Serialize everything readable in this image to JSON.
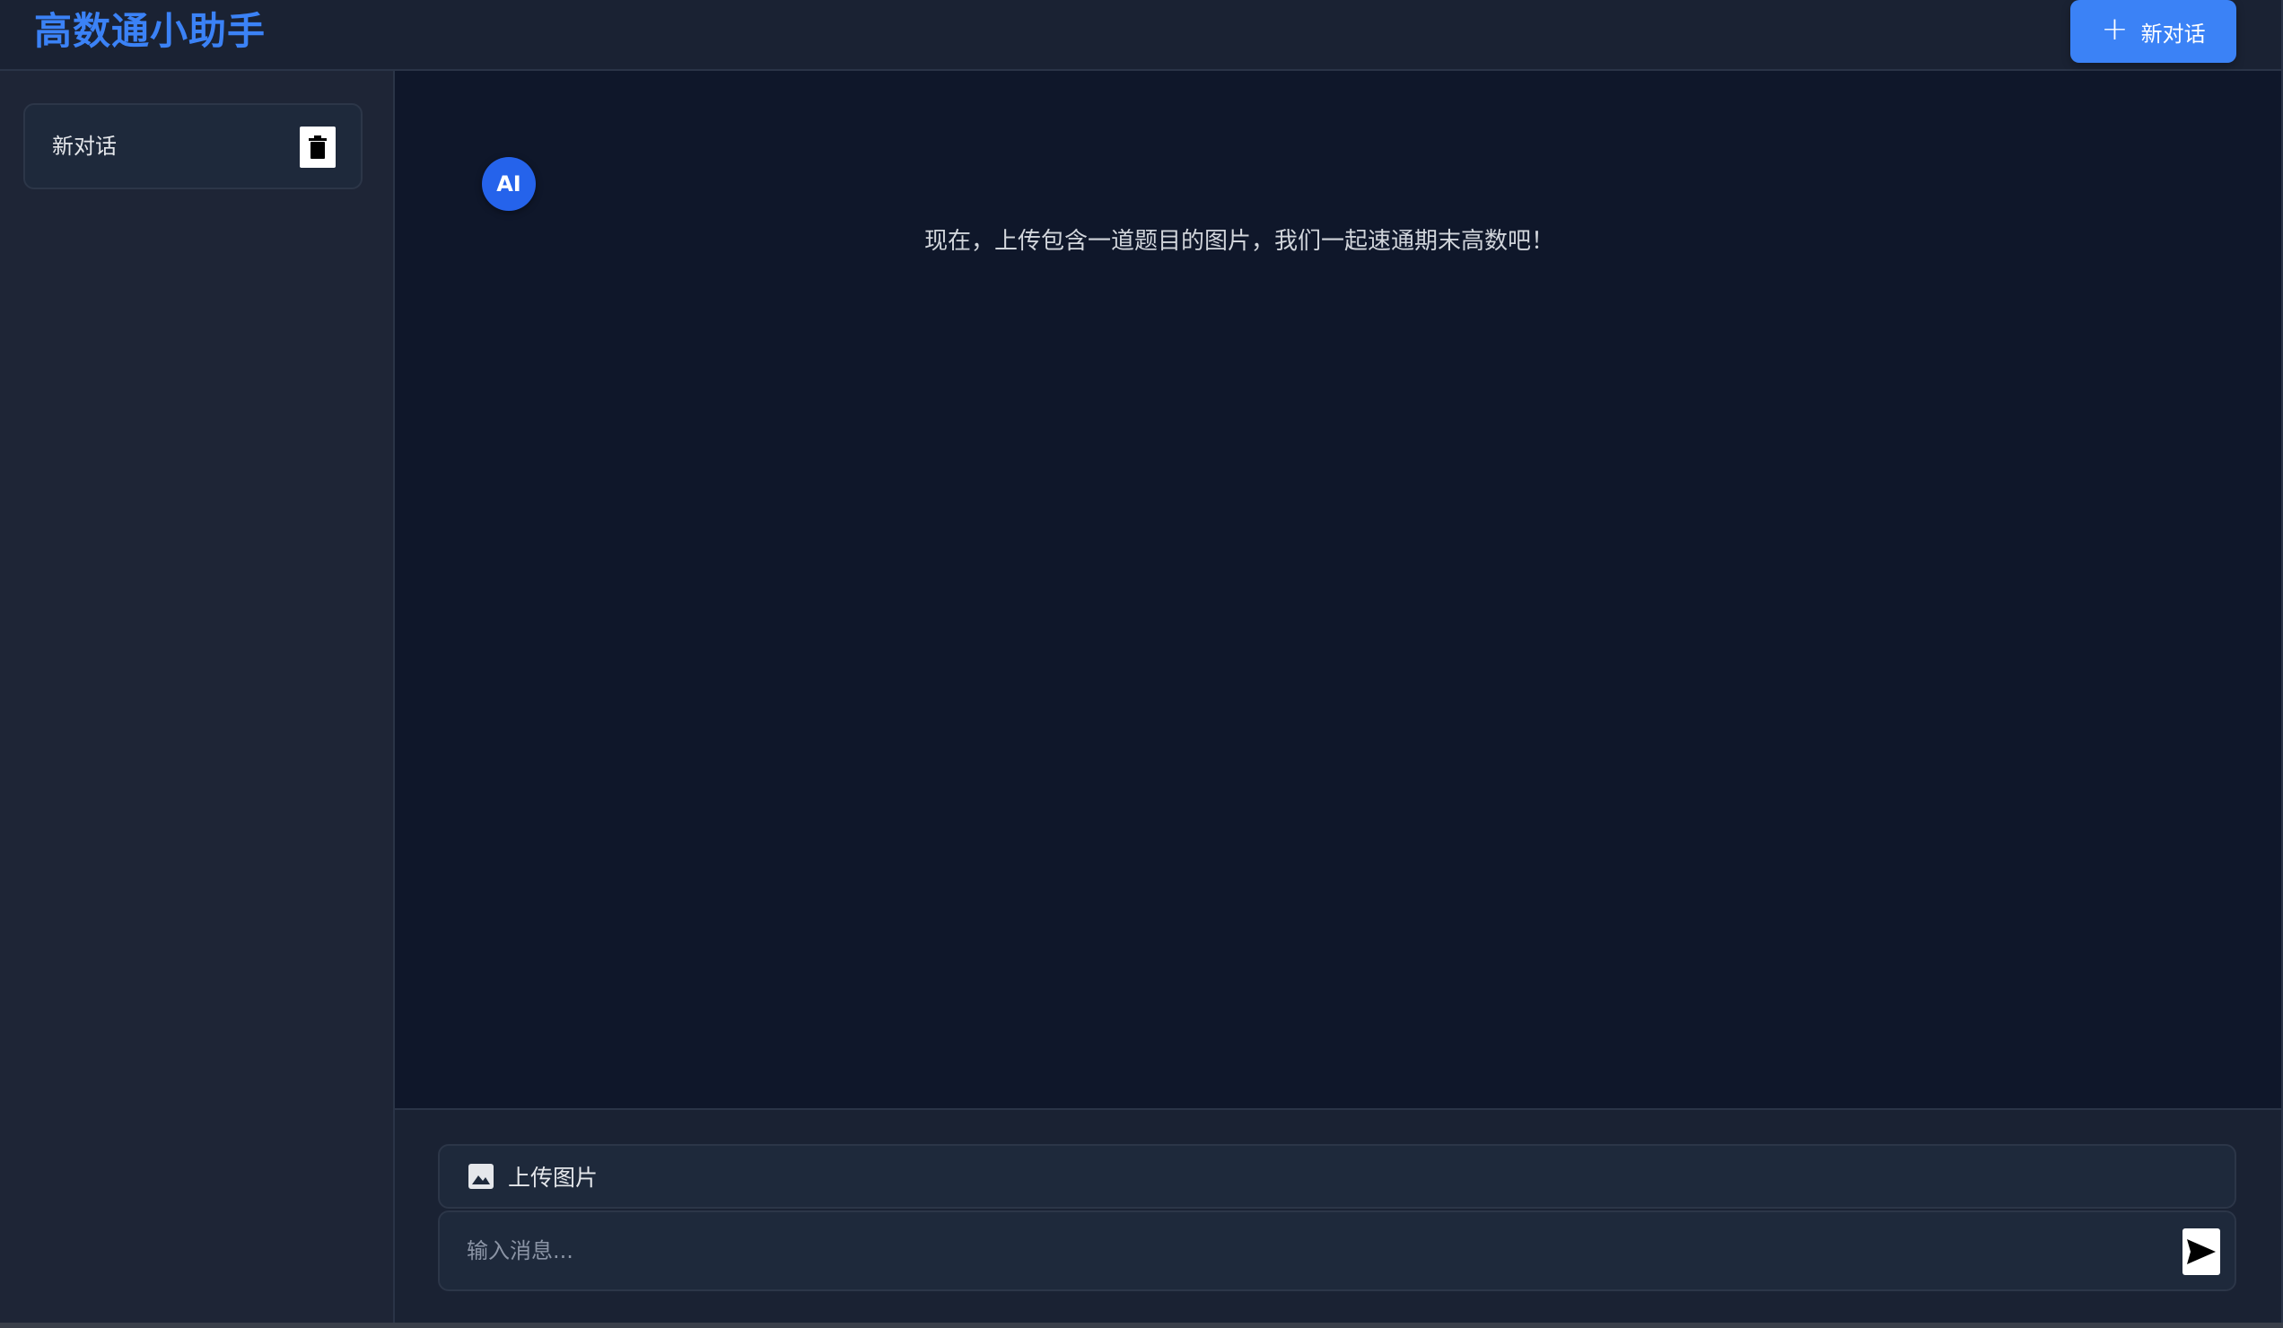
{
  "header": {
    "title": "高数通小助手",
    "new_chat_label": "新对话",
    "new_chat_icon": "plus-icon"
  },
  "sidebar": {
    "conversations": [
      {
        "label": "新对话",
        "delete_icon": "trash-icon"
      }
    ]
  },
  "chat": {
    "messages": [
      {
        "role": "AI",
        "avatar_label": "AI",
        "text": "现在，上传包含一道题目的图片，我们一起速通期末高数吧！"
      }
    ]
  },
  "composer": {
    "upload_label": "上传图片",
    "upload_icon": "image-icon",
    "input_placeholder": "输入消息...",
    "input_value": "",
    "send_icon": "send-icon"
  },
  "colors": {
    "accent": "#3b82f6",
    "background": "#0f172a",
    "panel": "#1e293b",
    "avatar": "#2563eb"
  }
}
